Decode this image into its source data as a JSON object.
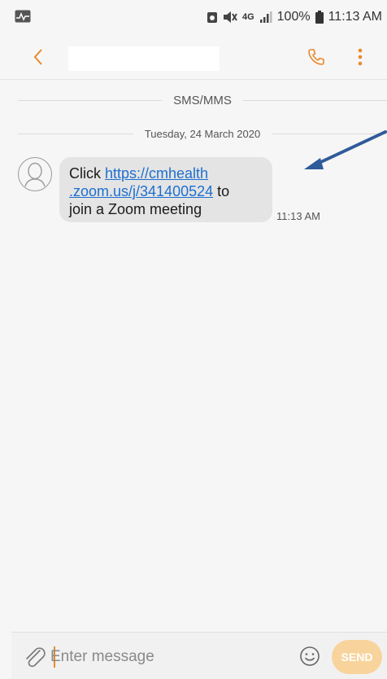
{
  "status_bar": {
    "network": "4G",
    "battery": "100%",
    "time": "11:13 AM"
  },
  "header": {
    "back_icon": "chevron-left-icon",
    "call_icon": "phone-icon",
    "more_icon": "more-vertical-icon",
    "accent_color": "#e88a2a"
  },
  "conversation": {
    "channel_label": "SMS/MMS",
    "date_label": "Tuesday, 24 March 2020",
    "messages": [
      {
        "text_before": "Click ",
        "link_line1": "https://cmhealth",
        "link_line2": ".zoom.us/j/341400524",
        "text_after_link": " to",
        "text_line3": "join a Zoom meeting",
        "time": "11:13 AM"
      }
    ]
  },
  "composer": {
    "placeholder": "Enter message",
    "send_label": "SEND",
    "send_color": "#f8d49c"
  }
}
